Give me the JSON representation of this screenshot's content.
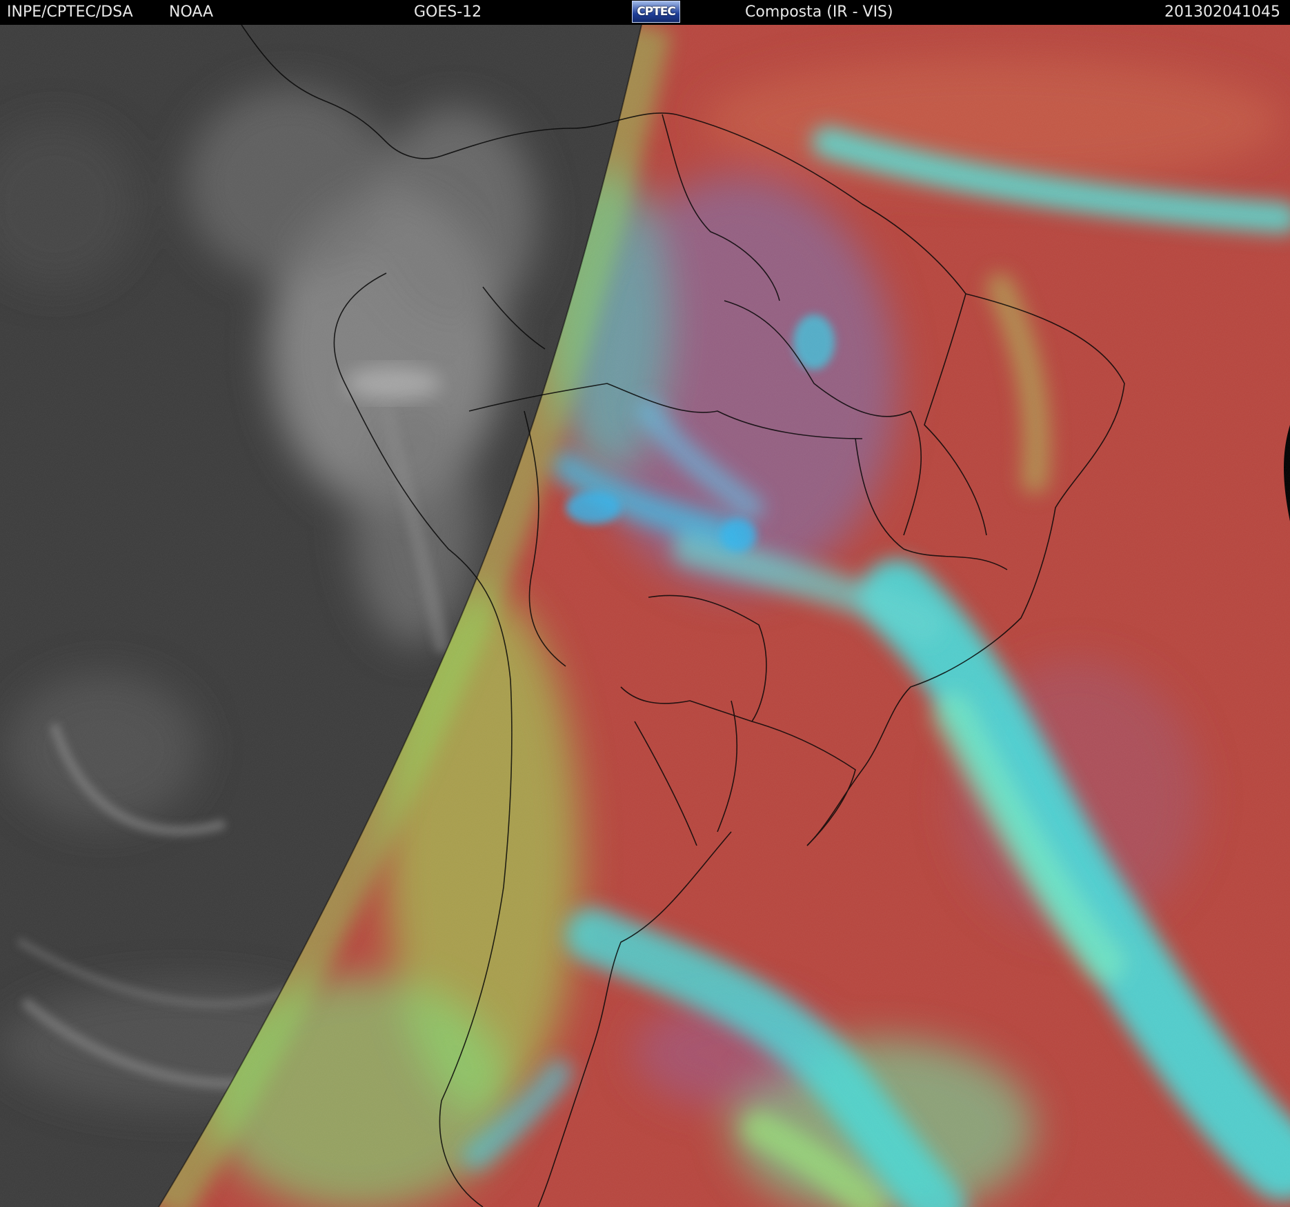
{
  "header": {
    "institution": "INPE/CPTEC/DSA",
    "agency": "NOAA",
    "satellite": "GOES-12",
    "logo_text": "CPTEC",
    "product": "Composta (IR - VIS)",
    "datetime": "201302041045"
  },
  "colors": {
    "background": "#000000",
    "header_text": "#e8e8e8",
    "ocean_night_gray": "#3c3c3c",
    "land_day_red": "#b8463e",
    "high_cloud_cyan": "#3ee6e6",
    "low_cloud_green": "#9cea5a",
    "mid_cloud_purple": "#8a4c86",
    "border_lines": "#000000"
  },
  "icons": {
    "logo": "cptec-logo-icon"
  }
}
